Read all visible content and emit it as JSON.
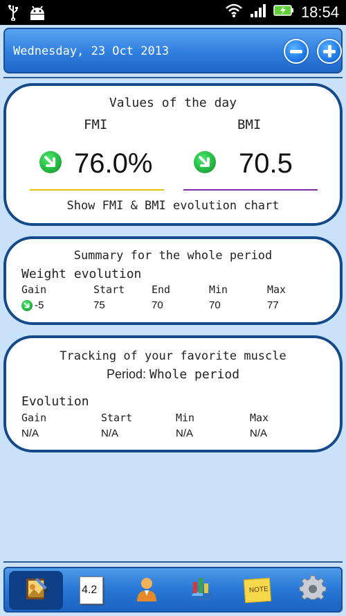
{
  "status_bar": {
    "time": "18:54"
  },
  "header": {
    "date": "Wednesday, 23 Oct 2013"
  },
  "values_card": {
    "title": "Values of the day",
    "fmi_label": "FMI",
    "bmi_label": "BMI",
    "fmi_value": "76.0%",
    "bmi_value": "70.5",
    "chart_link": "Show FMI & BMI evolution chart",
    "fmi_line_color": "#e8c400",
    "bmi_line_color": "#7a2aa8"
  },
  "summary_card": {
    "title": "Summary for the whole period",
    "subtitle": "Weight evolution",
    "columns": [
      "Gain",
      "Start",
      "End",
      "Min",
      "Max"
    ],
    "values": [
      "-5",
      "75",
      "70",
      "70",
      "77"
    ]
  },
  "muscle_card": {
    "title": "Tracking of your favorite muscle",
    "period_label": "Period:",
    "period_value": "Whole period",
    "subtitle": "Evolution",
    "columns": [
      "Gain",
      "Start",
      "Min",
      "Max"
    ],
    "values": [
      "N/A",
      "N/A",
      "N/A",
      "N/A"
    ]
  },
  "bottom_nav": {
    "items": [
      {
        "icon": "journal-icon"
      },
      {
        "icon": "value-icon",
        "label": "4.2"
      },
      {
        "icon": "profile-icon"
      },
      {
        "icon": "stats-chart-icon"
      },
      {
        "icon": "note-icon",
        "label": "NOTE"
      },
      {
        "icon": "gear-icon"
      }
    ]
  }
}
